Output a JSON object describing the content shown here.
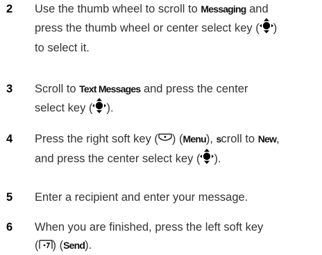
{
  "steps": [
    {
      "number": "2",
      "t1": "Use the thumb wheel to scroll to ",
      "b1": "Messaging",
      "t2": " and",
      "t3": "press the thumb wheel or center select key (",
      "t4": ")",
      "t5": "to select it."
    },
    {
      "number": "3",
      "t1": "Scroll to ",
      "b1": "Text Messages",
      "t2": " and press the center",
      "t3": "select key (",
      "t4": ")."
    },
    {
      "number": "4",
      "t1": "Press the right soft key (",
      "t2": ") (",
      "b1": "Menu",
      "t3": "), ",
      "b2": "s",
      "t4": "croll to ",
      "b3": "New",
      "t5": ",",
      "t6": "and press the center select key (",
      "t7": ")."
    },
    {
      "number": "5",
      "t1": "Enter a recipient and enter your message."
    },
    {
      "number": "6",
      "t1": "When you are finished, press the left soft key",
      "t2": "(",
      "t3": ") (",
      "b1": "Send",
      "t4": ")."
    }
  ],
  "icons": {
    "center_select": "center-select-key-icon",
    "right_soft": "right-soft-key-icon",
    "left_soft": "left-soft-key-icon"
  }
}
